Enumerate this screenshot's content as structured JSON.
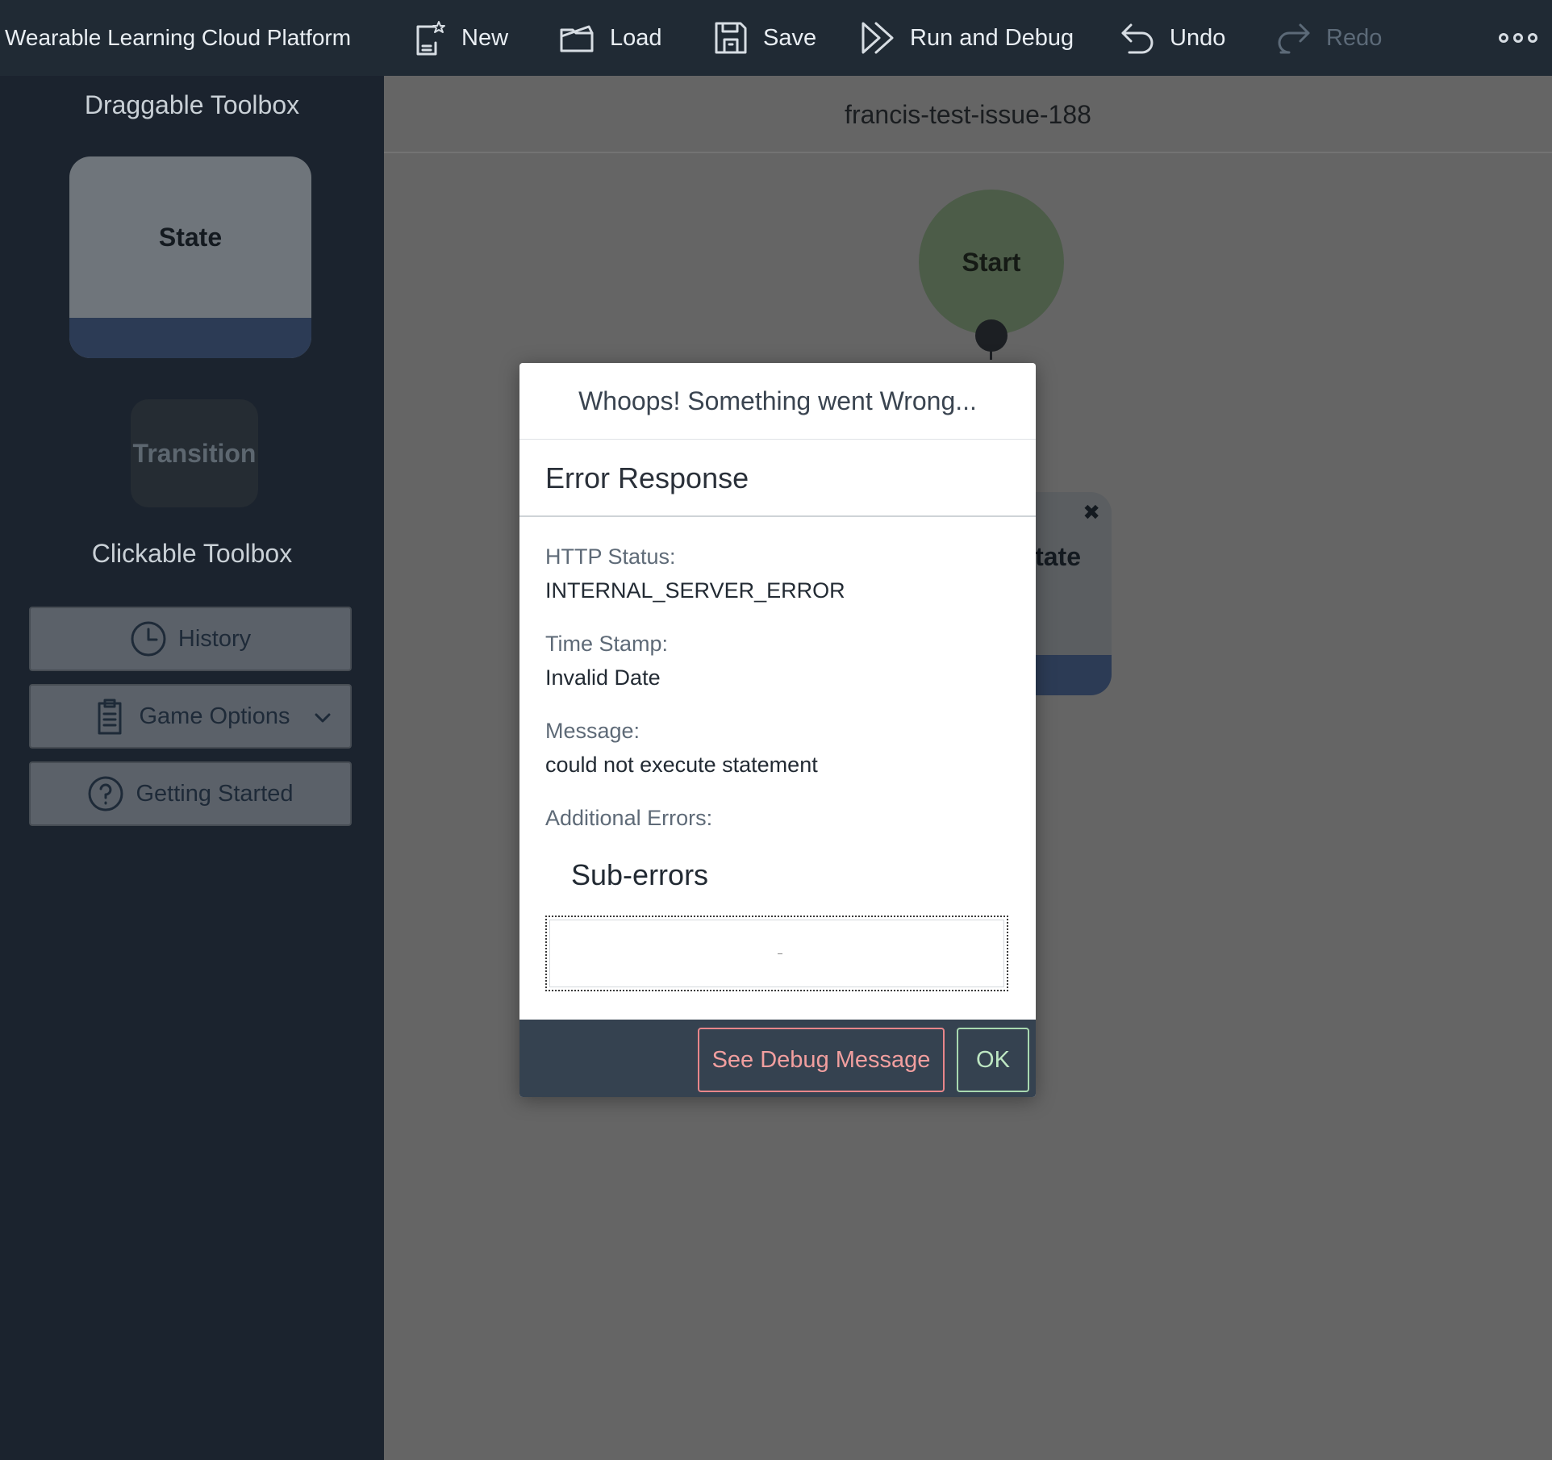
{
  "app": {
    "title": "Wearable Learning Cloud Platform"
  },
  "toolbar": {
    "new_label": "New",
    "load_label": "Load",
    "save_label": "Save",
    "run_label": "Run and Debug",
    "undo_label": "Undo",
    "redo_label": "Redo"
  },
  "sidebar": {
    "draggable_heading": "Draggable Toolbox",
    "state_label": "State",
    "transition_label": "Transition",
    "clickable_heading": "Clickable Toolbox",
    "history_label": "History",
    "game_options_label": "Game Options",
    "getting_started_label": "Getting Started"
  },
  "canvas": {
    "game_name": "francis-test-issue-188",
    "start_node_label": "Start",
    "state_node_label": "State"
  },
  "modal": {
    "title": "Whoops! Something went Wrong...",
    "subtitle": "Error Response",
    "http_status_label": "HTTP Status:",
    "http_status_value": "INTERNAL_SERVER_ERROR",
    "timestamp_label": "Time Stamp:",
    "timestamp_value": "Invalid Date",
    "message_label": "Message:",
    "message_value": "could not execute statement",
    "additional_label": "Additional Errors:",
    "suberrors_title": "Sub-errors",
    "debug_button": "See Debug Message",
    "ok_button": "OK"
  },
  "colors": {
    "topbar": "#202a34",
    "sidebar": "#1b232e",
    "canvas_overlay": "#656565",
    "start_node": "#4c5c48",
    "state_footer": "#2c3b55",
    "modal_footer": "#354250",
    "danger": "#e7868a",
    "success": "#a8d9b0"
  },
  "icons": [
    "new-document-icon",
    "folder-icon",
    "save-icon",
    "run-debug-icon",
    "undo-icon",
    "redo-icon",
    "more-icon",
    "history-clock-icon",
    "clipboard-icon",
    "chevron-down-icon",
    "help-circle-icon",
    "close-icon"
  ]
}
